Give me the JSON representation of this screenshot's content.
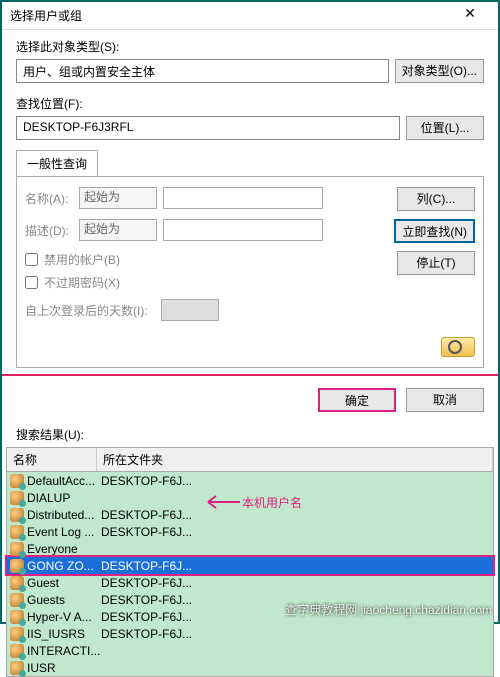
{
  "title": "选择用户或组",
  "objectType": {
    "label": "选择此对象类型(S):",
    "value": "用户、组或内置安全主体",
    "button": "对象类型(O)..."
  },
  "location": {
    "label": "查找位置(F):",
    "value": "DESKTOP-F6J3RFL",
    "button": "位置(L)..."
  },
  "tab": "一般性查询",
  "query": {
    "nameLabel": "名称(A):",
    "nameMode": "起始为",
    "descLabel": "描述(D):",
    "descMode": "起始为",
    "disabled": "禁用的帐户(B)",
    "noexpire": "不过期密码(X)",
    "daysLabel": "自上次登录后的天数(I):"
  },
  "buttons": {
    "columns": "列(C)...",
    "findNow": "立即查找(N)",
    "stop": "停止(T)",
    "ok": "确定",
    "cancel": "取消"
  },
  "resultsLabel": "搜索结果(U):",
  "headers": {
    "name": "名称",
    "folder": "所在文件夹"
  },
  "rows": [
    {
      "name": "DefaultAcc...",
      "folder": "DESKTOP-F6J..."
    },
    {
      "name": "DIALUP",
      "folder": ""
    },
    {
      "name": "Distributed...",
      "folder": "DESKTOP-F6J..."
    },
    {
      "name": "Event Log ...",
      "folder": "DESKTOP-F6J..."
    },
    {
      "name": "Everyone",
      "folder": ""
    },
    {
      "name": "GONG ZO...",
      "folder": "DESKTOP-F6J..."
    },
    {
      "name": "Guest",
      "folder": "DESKTOP-F6J..."
    },
    {
      "name": "Guests",
      "folder": "DESKTOP-F6J..."
    },
    {
      "name": "Hyper-V A...",
      "folder": "DESKTOP-F6J..."
    },
    {
      "name": "IIS_IUSRS",
      "folder": "DESKTOP-F6J..."
    },
    {
      "name": "INTERACTI...",
      "folder": ""
    },
    {
      "name": "IUSR",
      "folder": ""
    }
  ],
  "selectedIndex": 5,
  "annotation": "本机用户名",
  "watermark": "查字典教程网 jiaocheng.chazidian.com"
}
